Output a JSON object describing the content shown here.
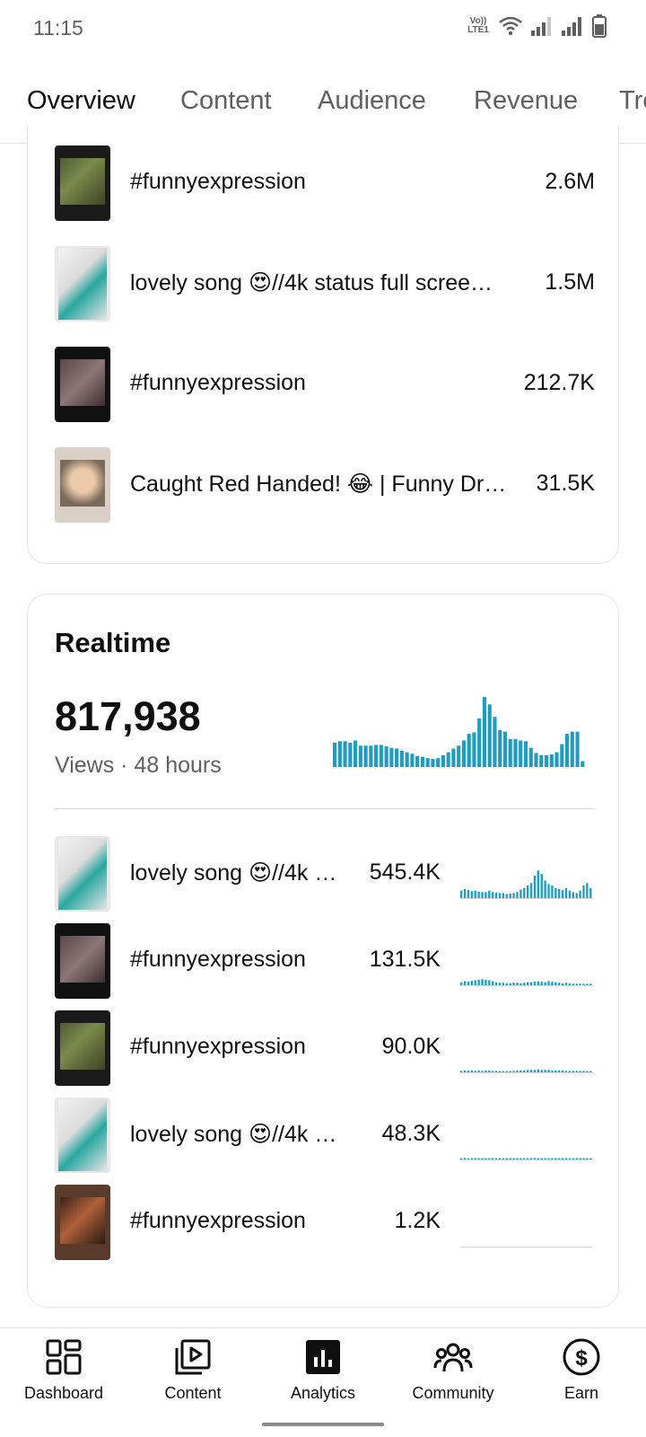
{
  "status_bar": {
    "time": "11:15",
    "network_label": "Vo)) LTE1"
  },
  "tabs": [
    {
      "label": "Overview",
      "active": true
    },
    {
      "label": "Content",
      "active": false
    },
    {
      "label": "Audience",
      "active": false
    },
    {
      "label": "Revenue",
      "active": false
    },
    {
      "label": "Tre",
      "active": false
    }
  ],
  "top_content": [
    {
      "title": "#funnyexpression",
      "value": "2.6M",
      "thumb": "green"
    },
    {
      "title": "lovely song 😍//4k status full scree…",
      "value": "1.5M",
      "thumb": "white"
    },
    {
      "title": "#funnyexpression",
      "value": "212.7K",
      "thumb": "portrait"
    },
    {
      "title": "Caught Red Handed! 😂 | Funny Dr…",
      "value": "31.5K",
      "thumb": "face"
    }
  ],
  "realtime": {
    "title": "Realtime",
    "views": "817,938",
    "subtitle": "Views · 48 hours",
    "bars": [
      0.33,
      0.35,
      0.35,
      0.33,
      0.36,
      0.29,
      0.29,
      0.29,
      0.3,
      0.3,
      0.28,
      0.26,
      0.25,
      0.22,
      0.2,
      0.18,
      0.15,
      0.14,
      0.12,
      0.11,
      0.12,
      0.16,
      0.2,
      0.25,
      0.29,
      0.36,
      0.45,
      0.47,
      0.66,
      0.95,
      0.85,
      0.68,
      0.5,
      0.48,
      0.38,
      0.38,
      0.36,
      0.35,
      0.26,
      0.19,
      0.16,
      0.16,
      0.17,
      0.2,
      0.31,
      0.45,
      0.48,
      0.48,
      0.08
    ],
    "color": "#1f9cbf",
    "items": [
      {
        "title": "lovely song 😍//4k …",
        "value": "545.4K",
        "thumb": "white",
        "spark": [
          0.15,
          0.18,
          0.16,
          0.14,
          0.15,
          0.13,
          0.12,
          0.12,
          0.15,
          0.12,
          0.11,
          0.1,
          0.1,
          0.08,
          0.09,
          0.1,
          0.12,
          0.17,
          0.2,
          0.25,
          0.3,
          0.45,
          0.55,
          0.48,
          0.35,
          0.28,
          0.25,
          0.2,
          0.18,
          0.16,
          0.2,
          0.15,
          0.12,
          0.1,
          0.15,
          0.25,
          0.3,
          0.2
        ]
      },
      {
        "title": "#funnyexpression",
        "value": "131.5K",
        "thumb": "portrait",
        "spark": [
          0.06,
          0.08,
          0.07,
          0.09,
          0.1,
          0.11,
          0.12,
          0.11,
          0.1,
          0.08,
          0.06,
          0.05,
          0.05,
          0.04,
          0.04,
          0.05,
          0.05,
          0.04,
          0.05,
          0.06,
          0.06,
          0.07,
          0.08,
          0.07,
          0.06,
          0.08,
          0.07,
          0.06,
          0.05,
          0.04,
          0.05,
          0.04,
          0.03,
          0.03,
          0.03,
          0.03,
          0.03,
          0.03
        ]
      },
      {
        "title": "#funnyexpression",
        "value": "90.0K",
        "thumb": "green",
        "spark": [
          0.03,
          0.04,
          0.04,
          0.04,
          0.03,
          0.04,
          0.03,
          0.04,
          0.04,
          0.03,
          0.03,
          0.02,
          0.02,
          0.02,
          0.02,
          0.03,
          0.04,
          0.04,
          0.04,
          0.05,
          0.05,
          0.05,
          0.06,
          0.05,
          0.05,
          0.05,
          0.04,
          0.04,
          0.04,
          0.04,
          0.03,
          0.03,
          0.03,
          0.03,
          0.03,
          0.03,
          0.02,
          0.02
        ]
      },
      {
        "title": "lovely song 😍//4k …",
        "value": "48.3K",
        "thumb": "white",
        "spark": [
          0.02,
          0.03,
          0.02,
          0.02,
          0.03,
          0.02,
          0.02,
          0.02,
          0.02,
          0.01,
          0.01,
          0.01,
          0.02,
          0.01,
          0.01,
          0.01,
          0.02,
          0.02,
          0.02,
          0.02,
          0.03,
          0.03,
          0.02,
          0.02,
          0.02,
          0.01,
          0.02,
          0.02,
          0.01,
          0.01,
          0.01,
          0.01,
          0.01,
          0.01,
          0.01,
          0.01,
          0.01,
          0.01
        ]
      },
      {
        "title": "#funnyexpression",
        "value": "1.2K",
        "thumb": "red",
        "spark": [
          0,
          0,
          0,
          0,
          0,
          0,
          0,
          0,
          0,
          0,
          0,
          0,
          0,
          0,
          0,
          0,
          0,
          0,
          0,
          0,
          0,
          0,
          0,
          0,
          0,
          0,
          0,
          0,
          0,
          0,
          0,
          0,
          0,
          0,
          0,
          0,
          0,
          0
        ]
      }
    ]
  },
  "bottom_nav": [
    {
      "label": "Dashboard",
      "icon": "dashboard-icon",
      "active": false
    },
    {
      "label": "Content",
      "icon": "content-icon",
      "active": false
    },
    {
      "label": "Analytics",
      "icon": "analytics-icon",
      "active": true
    },
    {
      "label": "Community",
      "icon": "community-icon",
      "active": false
    },
    {
      "label": "Earn",
      "icon": "earn-icon",
      "active": false
    }
  ]
}
